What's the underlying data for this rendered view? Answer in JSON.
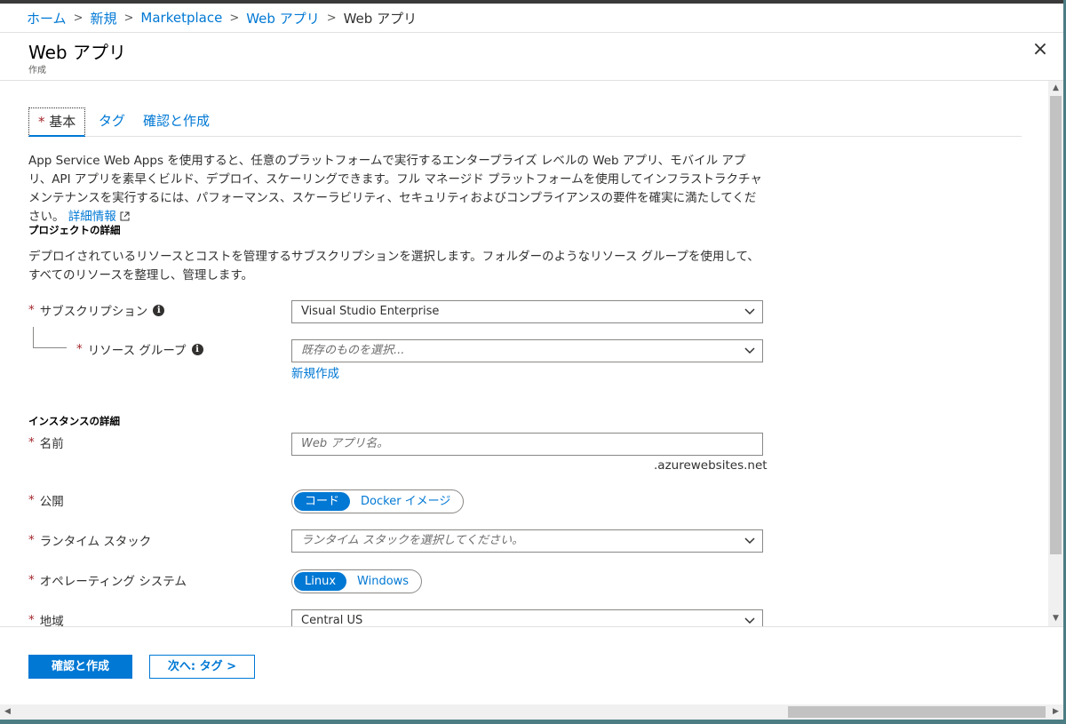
{
  "breadcrumb": {
    "items": [
      "ホーム",
      "新規",
      "Marketplace",
      "Web アプリ"
    ],
    "current": "Web アプリ",
    "separator": ">"
  },
  "header": {
    "title": "Web アプリ",
    "subtitle": "作成",
    "close_icon": "×"
  },
  "tabs": [
    {
      "label": "基本",
      "required_marker": "*",
      "active": true
    },
    {
      "label": "タグ",
      "active": false
    },
    {
      "label": "確認と作成",
      "active": false
    }
  ],
  "intro": {
    "text": "App Service Web Apps を使用すると、任意のプラットフォームで実行するエンタープライズ レベルの Web アプリ、モバイル アプリ、API アプリを素早くビルド、デプロイ、スケーリングできます。フル マネージド プラットフォームを使用してインフラストラクチャ メンテナンスを実行するには、パフォーマンス、スケーラビリティ、セキュリティおよびコンプライアンスの要件を確実に満たしてください。",
    "link": "詳細情報"
  },
  "project": {
    "heading": "プロジェクトの詳細",
    "description": "デプロイされているリソースとコストを管理するサブスクリプションを選択します。フォルダーのようなリソース グループを使用して、すべてのリソースを整理し、管理します。",
    "subscription": {
      "label": "サブスクリプション",
      "value": "Visual Studio Enterprise"
    },
    "resource_group": {
      "label": "リソース グループ",
      "placeholder": "既存のものを選択...",
      "create_link": "新規作成"
    }
  },
  "instance": {
    "heading": "インスタンスの詳細",
    "name": {
      "label": "名前",
      "placeholder": "Web アプリ名。",
      "suffix": ".azurewebsites.net"
    },
    "publish": {
      "label": "公開",
      "options": [
        "コード",
        "Docker イメージ"
      ],
      "selected": "コード"
    },
    "runtime": {
      "label": "ランタイム スタック",
      "placeholder": "ランタイム スタックを選択してください。"
    },
    "os": {
      "label": "オペレーティング システム",
      "options": [
        "Linux",
        "Windows"
      ],
      "selected": "Linux"
    },
    "region": {
      "label": "地域",
      "value": "Central US"
    }
  },
  "required_marker": "*",
  "info_icon": "i",
  "footer": {
    "review_create": "確認と作成",
    "next": "次へ: タグ >"
  },
  "colors": {
    "accent": "#0078d4",
    "required": "#a4262c",
    "text": "#323130"
  }
}
